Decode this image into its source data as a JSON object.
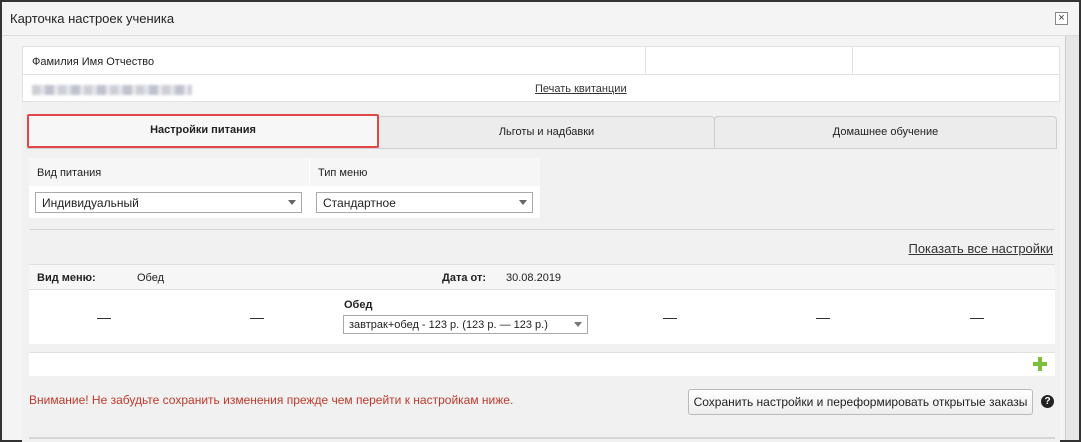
{
  "window": {
    "title": "Карточка настроек ученика",
    "close_glyph": "×"
  },
  "student": {
    "fio_label": "Фамилия Имя Отчество",
    "print_link": "Печать квитанции"
  },
  "tabs": [
    {
      "label": "Настройки питания",
      "active": true
    },
    {
      "label": "Льготы и надбавки",
      "active": false
    },
    {
      "label": "Домашнее обучение",
      "active": false
    }
  ],
  "nutrition": {
    "type_label": "Вид питания",
    "type_value": "Индивидуальный",
    "menu_label": "Тип меню",
    "menu_value": "Стандартное",
    "show_all": "Показать все настройки"
  },
  "menu": {
    "kind_label": "Вид меню:",
    "kind_value": "Обед",
    "date_label": "Дата от:",
    "date_value": "30.08.2019",
    "dash": "—",
    "meal_title": "Обед",
    "meal_value": "завтрак+обед - 123 р. (123 р. — 123 р.)"
  },
  "footer": {
    "warning": "Внимание! Не забудьте сохранить изменения прежде чем перейти к настройкам ниже.",
    "save_button": "Сохранить настройки и переформировать открытые заказы",
    "help_glyph": "?"
  },
  "colors": {
    "active_tab_border": "#e04747",
    "warning_text": "#c0392b",
    "add_icon": "#7cbf3b"
  }
}
